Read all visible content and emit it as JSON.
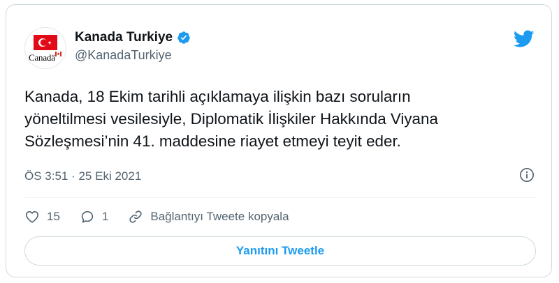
{
  "tweet": {
    "author": {
      "display_name": "Kanada Turkiye",
      "handle": "@KanadaTurkiye",
      "avatar_wordmark": "Canadä",
      "verified": true
    },
    "text_lines": [
      "Kanada, 18 Ekim tarihli açıklamaya ilişkin bazı soruların",
      "yöneltilmesi vesilesiyle, Diplomatik İlişkiler Hakkında Viyana",
      "Sözleşmesi’nin 41. maddesine riayet etmeyi teyit eder."
    ],
    "timestamp": "ÖS 3:51 · 25 Eki 2021",
    "actions": {
      "like_count": "15",
      "reply_count": "1",
      "copy_link_label": "Bağlantıyı Tweete kopyala"
    },
    "reply_button_label": "Yanıtını Tweetle"
  },
  "icons": {
    "brand": "twitter-bird-icon",
    "verified": "verified-badge-icon",
    "info": "info-icon",
    "like": "heart-icon",
    "reply": "speech-bubble-icon",
    "link": "link-icon"
  },
  "colors": {
    "brand_blue": "#1d9bf0",
    "text_primary": "#0f1419",
    "text_secondary": "#536471",
    "border": "#cfd9de",
    "flag_red": "#e30a17"
  }
}
